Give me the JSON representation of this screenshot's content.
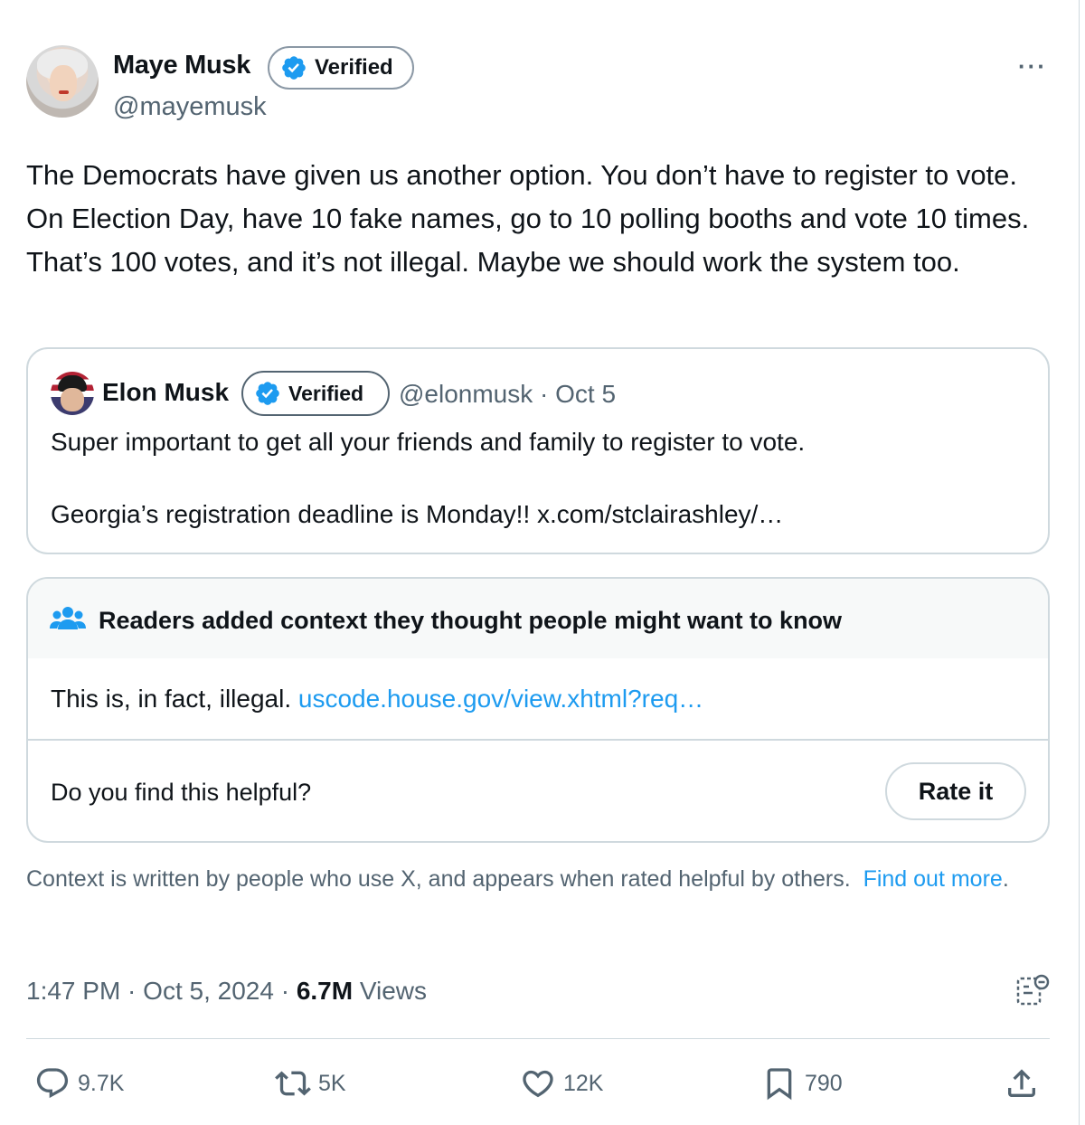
{
  "author": {
    "name": "Maye Musk",
    "verified_label": "Verified",
    "handle": "@mayemusk"
  },
  "more_label": "···",
  "tweet_text": "The Democrats have given us another option. You don’t have to register to vote. On Election Day, have 10 fake names, go to 10 polling booths and vote 10 times. That’s 100 votes, and it’s not illegal. Maybe we should work the system too.",
  "quote": {
    "name": "Elon Musk",
    "verified_label": "Verified",
    "meta": "@elonmusk · Oct 5",
    "line1": "Super important to get all your friends and family to register to vote.",
    "line2": "Georgia’s registration deadline is Monday!! x.com/stclairashley/…"
  },
  "note": {
    "title": "Readers added context they thought people might want to know",
    "body_text": "This is, in fact, illegal.",
    "body_link": "uscode.house.gov/view.xhtml?req…",
    "question": "Do you find this helpful?",
    "rate_label": "Rate it"
  },
  "context": {
    "text": "Context is written by people who use X, and appears when rated helpful by others.",
    "link": "Find out more",
    "period": "."
  },
  "meta": {
    "timestamp": "1:47 PM · Oct 5, 2024 · ",
    "views_count": "6.7M",
    "views_label": "Views"
  },
  "actions": {
    "replies": "9.7K",
    "reposts": "5K",
    "likes": "12K",
    "bookmarks": "790"
  },
  "colors": {
    "accent": "#1d9bf0",
    "text": "#0f1419",
    "secondary": "#536471",
    "border": "#cfd9de"
  }
}
